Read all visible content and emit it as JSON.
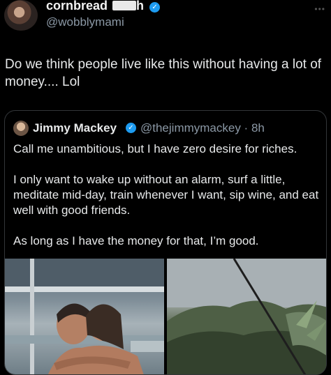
{
  "author": {
    "display_name_start": "cornbread",
    "display_name_end": "h",
    "handle": "@wobblymami",
    "verified": true
  },
  "more_label": "•••",
  "tweet": {
    "text": "Do we think people live like this without having a lot of money.... Lol"
  },
  "quoted": {
    "name": "Jimmy Mackey",
    "handle_time": "@thejimmymackey · 8h",
    "verified": true,
    "paragraphs": [
      "Call me unambitious, but I have zero desire for riches.",
      "I only want to wake up without an alarm, surf a little, meditate mid-day, train whenever I want, sip wine, and eat well with good friends.",
      "As long as I have the money for that, I’m good."
    ]
  },
  "colors": {
    "background": "#000000",
    "text": "#e7e9ea",
    "secondary_text": "#8b98a5",
    "verified_badge": "#1d9bf0",
    "card_border": "#333639"
  },
  "icons": {
    "verified": "verified-badge-icon",
    "more": "more-dots-icon"
  }
}
